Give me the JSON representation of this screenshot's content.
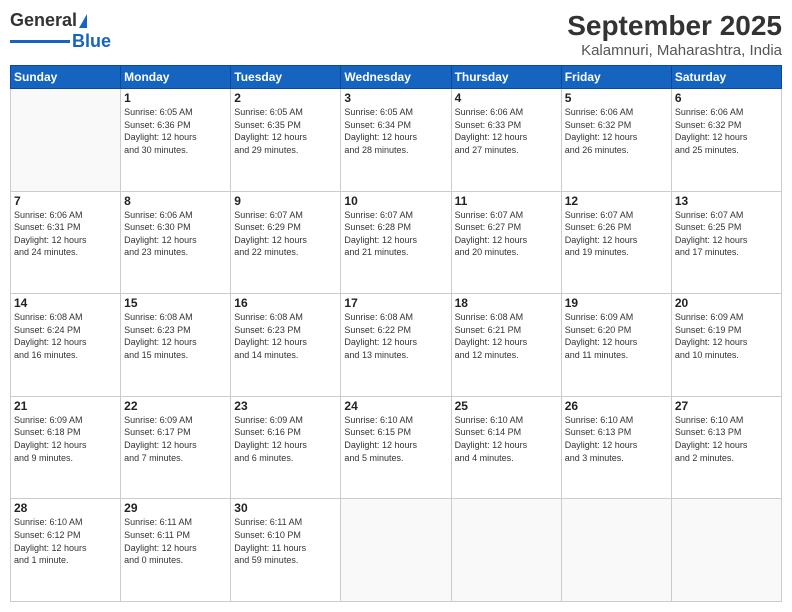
{
  "logo": {
    "general": "General",
    "blue": "Blue"
  },
  "header": {
    "month": "September 2025",
    "location": "Kalamnuri, Maharashtra, India"
  },
  "weekdays": [
    "Sunday",
    "Monday",
    "Tuesday",
    "Wednesday",
    "Thursday",
    "Friday",
    "Saturday"
  ],
  "weeks": [
    [
      {
        "day": "",
        "info": ""
      },
      {
        "day": "1",
        "info": "Sunrise: 6:05 AM\nSunset: 6:36 PM\nDaylight: 12 hours\nand 30 minutes."
      },
      {
        "day": "2",
        "info": "Sunrise: 6:05 AM\nSunset: 6:35 PM\nDaylight: 12 hours\nand 29 minutes."
      },
      {
        "day": "3",
        "info": "Sunrise: 6:05 AM\nSunset: 6:34 PM\nDaylight: 12 hours\nand 28 minutes."
      },
      {
        "day": "4",
        "info": "Sunrise: 6:06 AM\nSunset: 6:33 PM\nDaylight: 12 hours\nand 27 minutes."
      },
      {
        "day": "5",
        "info": "Sunrise: 6:06 AM\nSunset: 6:32 PM\nDaylight: 12 hours\nand 26 minutes."
      },
      {
        "day": "6",
        "info": "Sunrise: 6:06 AM\nSunset: 6:32 PM\nDaylight: 12 hours\nand 25 minutes."
      }
    ],
    [
      {
        "day": "7",
        "info": "Sunrise: 6:06 AM\nSunset: 6:31 PM\nDaylight: 12 hours\nand 24 minutes."
      },
      {
        "day": "8",
        "info": "Sunrise: 6:06 AM\nSunset: 6:30 PM\nDaylight: 12 hours\nand 23 minutes."
      },
      {
        "day": "9",
        "info": "Sunrise: 6:07 AM\nSunset: 6:29 PM\nDaylight: 12 hours\nand 22 minutes."
      },
      {
        "day": "10",
        "info": "Sunrise: 6:07 AM\nSunset: 6:28 PM\nDaylight: 12 hours\nand 21 minutes."
      },
      {
        "day": "11",
        "info": "Sunrise: 6:07 AM\nSunset: 6:27 PM\nDaylight: 12 hours\nand 20 minutes."
      },
      {
        "day": "12",
        "info": "Sunrise: 6:07 AM\nSunset: 6:26 PM\nDaylight: 12 hours\nand 19 minutes."
      },
      {
        "day": "13",
        "info": "Sunrise: 6:07 AM\nSunset: 6:25 PM\nDaylight: 12 hours\nand 17 minutes."
      }
    ],
    [
      {
        "day": "14",
        "info": "Sunrise: 6:08 AM\nSunset: 6:24 PM\nDaylight: 12 hours\nand 16 minutes."
      },
      {
        "day": "15",
        "info": "Sunrise: 6:08 AM\nSunset: 6:23 PM\nDaylight: 12 hours\nand 15 minutes."
      },
      {
        "day": "16",
        "info": "Sunrise: 6:08 AM\nSunset: 6:23 PM\nDaylight: 12 hours\nand 14 minutes."
      },
      {
        "day": "17",
        "info": "Sunrise: 6:08 AM\nSunset: 6:22 PM\nDaylight: 12 hours\nand 13 minutes."
      },
      {
        "day": "18",
        "info": "Sunrise: 6:08 AM\nSunset: 6:21 PM\nDaylight: 12 hours\nand 12 minutes."
      },
      {
        "day": "19",
        "info": "Sunrise: 6:09 AM\nSunset: 6:20 PM\nDaylight: 12 hours\nand 11 minutes."
      },
      {
        "day": "20",
        "info": "Sunrise: 6:09 AM\nSunset: 6:19 PM\nDaylight: 12 hours\nand 10 minutes."
      }
    ],
    [
      {
        "day": "21",
        "info": "Sunrise: 6:09 AM\nSunset: 6:18 PM\nDaylight: 12 hours\nand 9 minutes."
      },
      {
        "day": "22",
        "info": "Sunrise: 6:09 AM\nSunset: 6:17 PM\nDaylight: 12 hours\nand 7 minutes."
      },
      {
        "day": "23",
        "info": "Sunrise: 6:09 AM\nSunset: 6:16 PM\nDaylight: 12 hours\nand 6 minutes."
      },
      {
        "day": "24",
        "info": "Sunrise: 6:10 AM\nSunset: 6:15 PM\nDaylight: 12 hours\nand 5 minutes."
      },
      {
        "day": "25",
        "info": "Sunrise: 6:10 AM\nSunset: 6:14 PM\nDaylight: 12 hours\nand 4 minutes."
      },
      {
        "day": "26",
        "info": "Sunrise: 6:10 AM\nSunset: 6:13 PM\nDaylight: 12 hours\nand 3 minutes."
      },
      {
        "day": "27",
        "info": "Sunrise: 6:10 AM\nSunset: 6:13 PM\nDaylight: 12 hours\nand 2 minutes."
      }
    ],
    [
      {
        "day": "28",
        "info": "Sunrise: 6:10 AM\nSunset: 6:12 PM\nDaylight: 12 hours\nand 1 minute."
      },
      {
        "day": "29",
        "info": "Sunrise: 6:11 AM\nSunset: 6:11 PM\nDaylight: 12 hours\nand 0 minutes."
      },
      {
        "day": "30",
        "info": "Sunrise: 6:11 AM\nSunset: 6:10 PM\nDaylight: 11 hours\nand 59 minutes."
      },
      {
        "day": "",
        "info": ""
      },
      {
        "day": "",
        "info": ""
      },
      {
        "day": "",
        "info": ""
      },
      {
        "day": "",
        "info": ""
      }
    ]
  ]
}
